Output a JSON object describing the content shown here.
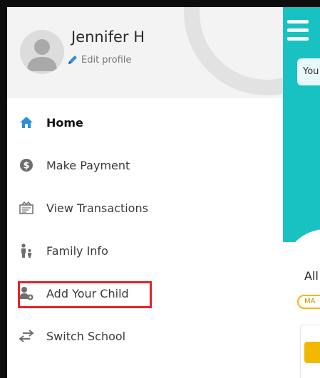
{
  "profile": {
    "name": "Jennifer H",
    "edit_label": "Edit profile",
    "avatar_icon": "user-silhouette-icon"
  },
  "nav": {
    "items": [
      {
        "label": "Home",
        "icon": "home-icon",
        "active": true
      },
      {
        "label": "Make Payment",
        "icon": "dollar-circle-icon",
        "active": false
      },
      {
        "label": "View Transactions",
        "icon": "receipt-icon",
        "active": false
      },
      {
        "label": "Family Info",
        "icon": "family-icon",
        "active": false
      },
      {
        "label": "Add Your Child",
        "icon": "add-user-icon",
        "active": false,
        "highlighted": true
      },
      {
        "label": "Switch School",
        "icon": "swap-arrows-icon",
        "active": false
      }
    ]
  },
  "background_app": {
    "pill_text": "You",
    "section_text": "All",
    "badge_text": "MA",
    "icon": "menu-icon"
  },
  "colors": {
    "accent_teal": "#19c2c2",
    "home_icon_blue": "#2e8fd6",
    "edit_icon_blue": "#2e8fd6",
    "highlight_red": "#e8222a",
    "badge_yellow": "#f2b800"
  }
}
